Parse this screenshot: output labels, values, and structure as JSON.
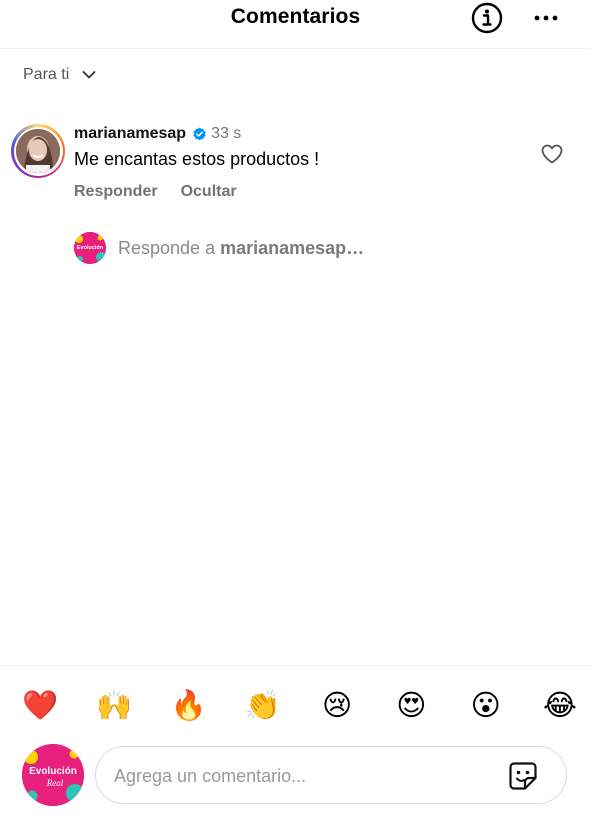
{
  "header": {
    "title": "Comentarios",
    "info_icon": "info-circle-icon",
    "more_icon": "more-horizontal-icon"
  },
  "sort": {
    "label": "Para ti",
    "icon": "chevron-down-icon"
  },
  "comment": {
    "username": "marianamesap",
    "verified": true,
    "time": "33 s",
    "text": "Me encantas estos productos !",
    "actions": {
      "reply": "Responder",
      "hide": "Ocultar"
    }
  },
  "reply_prompt": {
    "prefix": "Responde a",
    "username": "marianamesap…"
  },
  "emoji_bar": [
    "❤️",
    "🙌",
    "🔥",
    "👏",
    "😢",
    "😍",
    "😮",
    "😂"
  ],
  "composer": {
    "placeholder": "Agrega un comentario...",
    "sticker_icon": "sticker-icon"
  },
  "brand": {
    "logo_text": "Evolución",
    "logo_script": "Real",
    "logo_color": "#e8207d"
  },
  "colors": {
    "verified": "#0095f6",
    "muted_text": "#737373"
  }
}
